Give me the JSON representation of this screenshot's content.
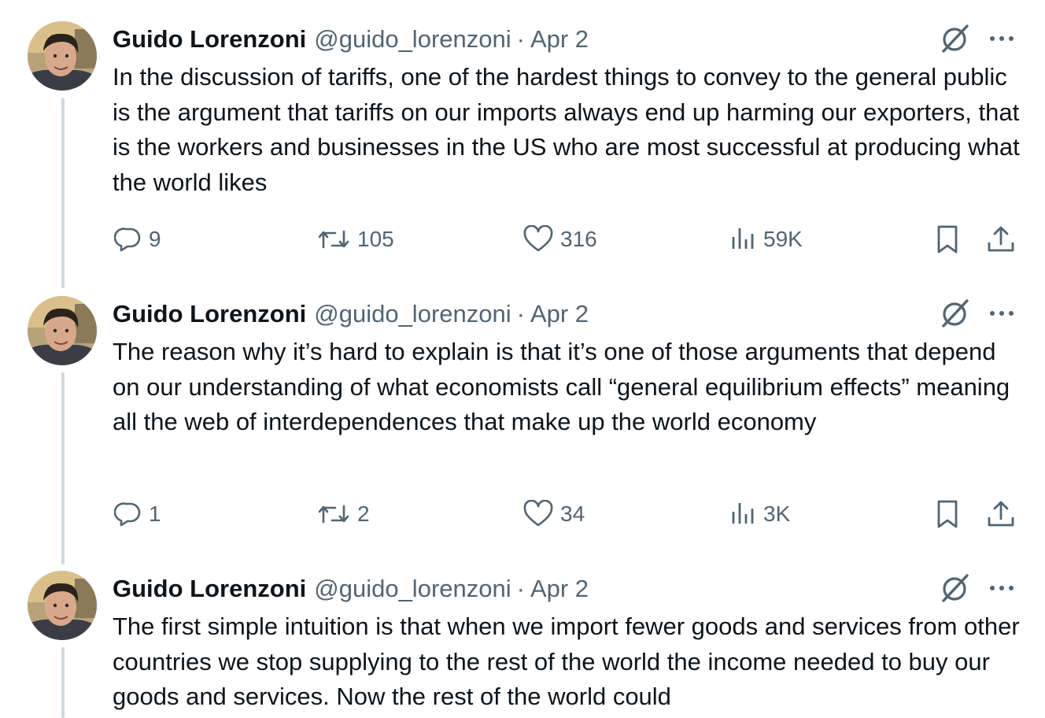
{
  "tweets": [
    {
      "name": "Guido Lorenzoni",
      "handle": "@guido_lorenzoni",
      "separator": "·",
      "date": "Apr 2",
      "text": "In the discussion of tariffs, one of the hardest things to convey to the general public is the argument that tariffs on our imports always end up harming our exporters, that is the workers and businesses in the US who are most successful at producing what the world likes",
      "replies": "9",
      "reposts": "105",
      "likes": "316",
      "views": "59K"
    },
    {
      "name": "Guido Lorenzoni",
      "handle": "@guido_lorenzoni",
      "separator": "·",
      "date": "Apr 2",
      "text": "The reason why it’s hard to explain is that it’s one of those arguments that depend on our understanding of what economists call “general equilibrium effects” meaning all the web of interdependences that make up the world economy",
      "replies": "1",
      "reposts": "2",
      "likes": "34",
      "views": "3K"
    },
    {
      "name": "Guido Lorenzoni",
      "handle": "@guido_lorenzoni",
      "separator": "·",
      "date": "Apr 2",
      "text": "The first simple intuition is that when we import fewer goods and services from other countries we stop supplying to the rest of the world the income needed to buy our goods and services. Now the rest of the world could",
      "replies": "",
      "reposts": "",
      "likes": "",
      "views": ""
    }
  ],
  "icons": {
    "reply": "reply-icon",
    "repost": "repost-icon",
    "like": "heart-icon",
    "views": "views-icon",
    "bookmark": "bookmark-icon",
    "share": "share-icon",
    "grok": "grok-icon",
    "more": "more-icon"
  },
  "colors": {
    "text": "#0f1419",
    "secondary": "#536471",
    "thread_line": "#cfd9de",
    "background": "#ffffff"
  }
}
